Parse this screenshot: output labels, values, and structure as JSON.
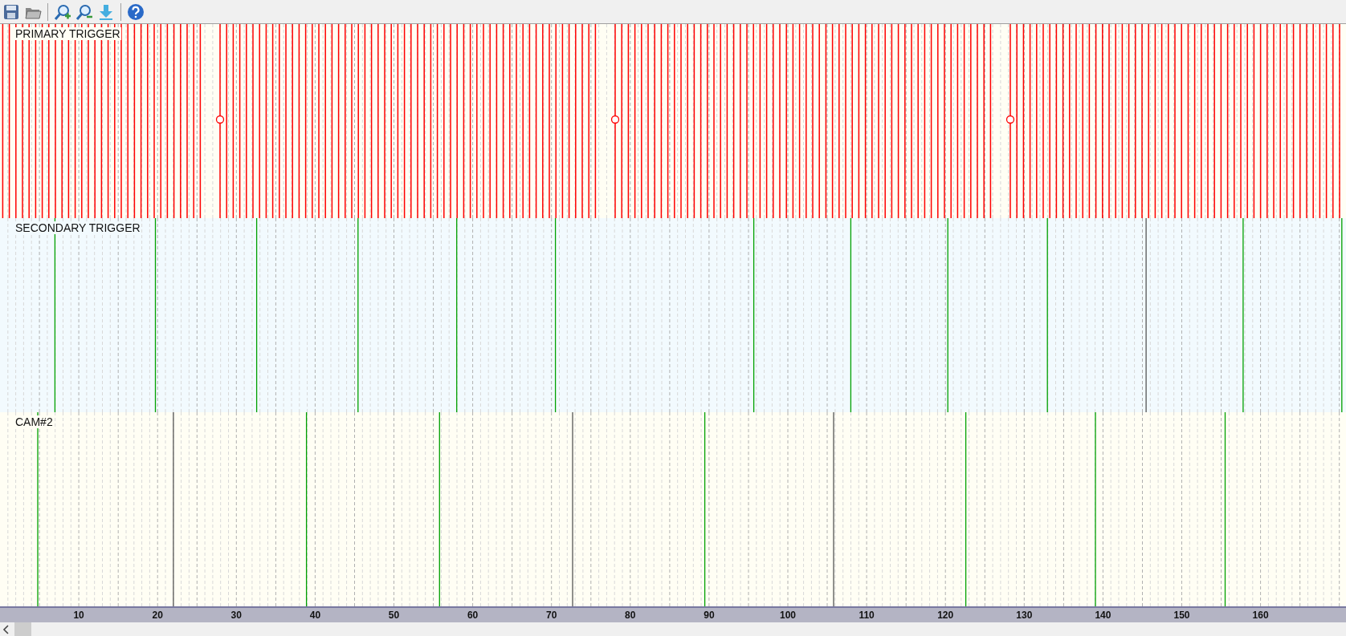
{
  "toolbar": [
    {
      "kind": "save"
    },
    {
      "kind": "open"
    },
    {
      "kind": "separator"
    },
    {
      "kind": "zoom-in"
    },
    {
      "kind": "zoom-out"
    },
    {
      "kind": "download"
    },
    {
      "kind": "separator"
    },
    {
      "kind": "help"
    }
  ],
  "panels": [
    {
      "label": "PRIMARY TRIGGER",
      "color": "#ff0000"
    },
    {
      "label": "SECONDARY TRIGGER",
      "color": "#00a000"
    },
    {
      "label": "CAM#2",
      "color": "#00a000"
    }
  ],
  "axis": {
    "ticks": [
      "10",
      "20",
      "30",
      "40",
      "50",
      "60",
      "70",
      "80",
      "90",
      "100",
      "110",
      "120",
      "130",
      "140",
      "150",
      "160"
    ]
  }
}
